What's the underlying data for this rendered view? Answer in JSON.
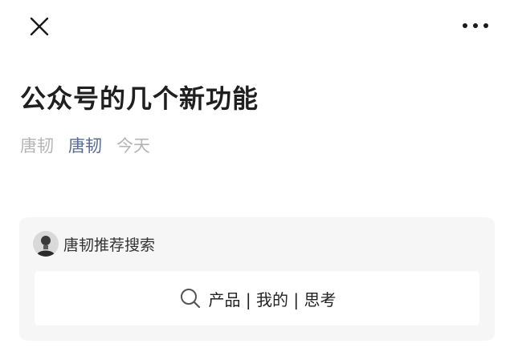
{
  "topbar": {
    "close_icon": "close-icon",
    "more_icon": "more-dots-icon"
  },
  "article": {
    "title": "公众号的几个新功能",
    "author": "唐韧",
    "account": "唐韧",
    "date": "今天"
  },
  "recommended_search": {
    "avatar_icon": "avatar",
    "title": "唐韧推荐搜索",
    "search_icon": "search-icon",
    "query": "产品 | 我的 | 思考"
  },
  "colors": {
    "link": "#576b95",
    "muted": "#b5b5b5",
    "card_bg": "#f6f6f6"
  }
}
